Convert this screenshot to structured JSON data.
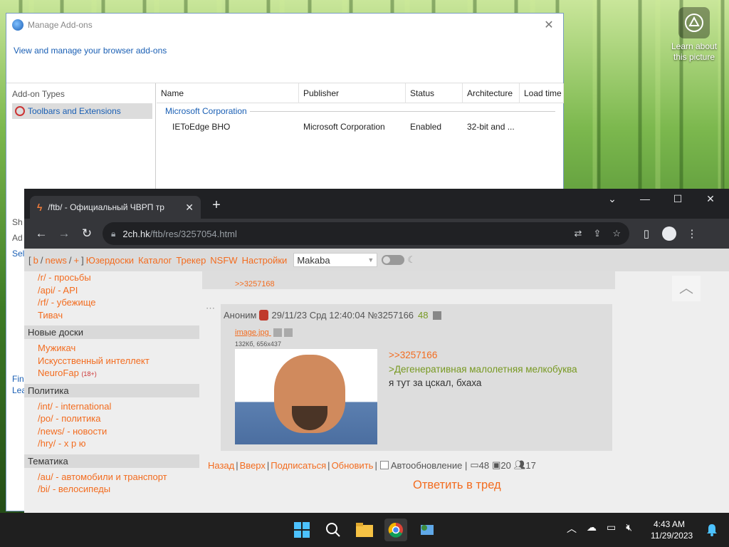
{
  "desktop": {
    "learn_label": "Learn about this picture"
  },
  "addons": {
    "title": "Manage Add-ons",
    "subtitle": "View and manage your browser add-ons",
    "addon_types_label": "Add-on Types",
    "selected_type": "Toolbars and Extensions",
    "partial_left_1": "Sh",
    "partial_left_2": "Ad",
    "partial_left_3": "Sele",
    "partial_left_4": "Fin",
    "partial_left_5": "Lea",
    "columns": [
      "Name",
      "Publisher",
      "Status",
      "Architecture",
      "Load time"
    ],
    "group": "Microsoft Corporation",
    "rows": [
      {
        "name": "IEToEdge BHO",
        "publisher": "Microsoft Corporation",
        "status": "Enabled",
        "arch": "32-bit and ..."
      }
    ]
  },
  "chrome": {
    "tab_title": "/ftb/ - Официальный ЧВРП тр",
    "url_host": "2ch.hk",
    "url_path": "/ftb/res/3257054.html"
  },
  "page": {
    "nav": {
      "b": "b",
      "news": "news",
      "plus": "+",
      "links": [
        "Юзердоски",
        "Каталог",
        "Трекер",
        "NSFW",
        "Настройки"
      ],
      "style_select": "Makaba"
    },
    "sidebar": {
      "top_links": [
        {
          "board": "/r/",
          "desc": " - просьбы"
        },
        {
          "board": "/api/",
          "desc": " - API"
        },
        {
          "board": "/rf/",
          "desc": " - убежище"
        },
        {
          "board": "",
          "desc": "Тивач"
        }
      ],
      "sections": [
        {
          "title": "Новые доски",
          "links": [
            {
              "board": "",
              "desc": "Мужикач",
              "tag": ""
            },
            {
              "board": "",
              "desc": "Искусственный интеллект",
              "tag": ""
            },
            {
              "board": "",
              "desc": "NeuroFap",
              "tag": "(18+)"
            }
          ]
        },
        {
          "title": "Политика",
          "links": [
            {
              "board": "/int/",
              "desc": " - international",
              "tag": ""
            },
            {
              "board": "/po/",
              "desc": " - политика",
              "tag": ""
            },
            {
              "board": "/news/",
              "desc": " - новости",
              "tag": ""
            },
            {
              "board": "/hry/",
              "desc": " - х р ю",
              "tag": ""
            }
          ]
        },
        {
          "title": "Тематика",
          "links": [
            {
              "board": "/au/",
              "desc": " - автомобили и транспорт",
              "tag": ""
            },
            {
              "board": "/bi/",
              "desc": " - велосипеды",
              "tag": ""
            }
          ]
        }
      ]
    },
    "top_reply_ref": ">>3257168",
    "post": {
      "name": "Аноним",
      "datetime": "29/11/23 Срд 12:40:04",
      "number": "№3257166",
      "reply_count": "48",
      "file_name": "image.jpg",
      "file_meta": "132Кб, 656x437",
      "ref": ">>3257166",
      "greentext": ">Дегенеративная малолетняя мелкобуква",
      "text": "я тут за цскал, бхаха"
    },
    "thread_nav": {
      "back": "Назад",
      "up": "Вверх",
      "subscribe": "Подписаться",
      "refresh": "Обновить",
      "autorefresh": "Автообновление",
      "posts": "48",
      "images": "20",
      "users": "17"
    },
    "reply_button": "Ответить в тред"
  },
  "taskbar": {
    "time": "4:43 AM",
    "date": "11/29/2023"
  }
}
